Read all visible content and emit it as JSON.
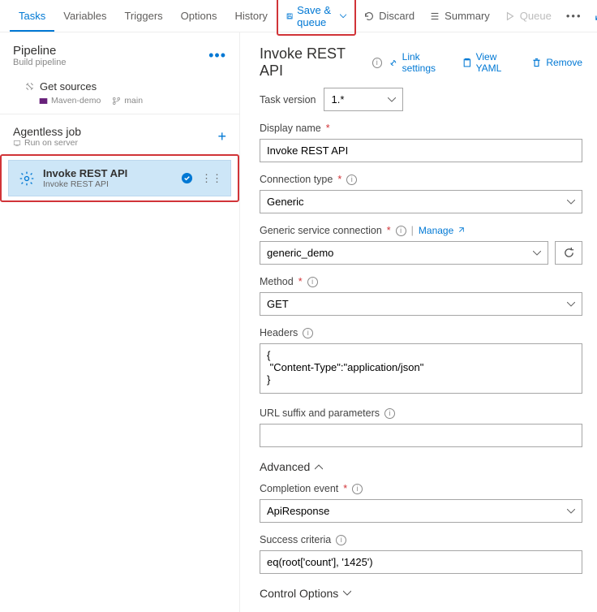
{
  "tabs": [
    "Tasks",
    "Variables",
    "Triggers",
    "Options",
    "History"
  ],
  "toolbar": {
    "save_queue": "Save & queue",
    "discard": "Discard",
    "summary": "Summary",
    "queue": "Queue"
  },
  "left": {
    "pipeline_title": "Pipeline",
    "pipeline_sub": "Build pipeline",
    "get_sources": "Get sources",
    "repo": "Maven-demo",
    "branch": "main",
    "job_title": "Agentless job",
    "job_sub": "Run on server",
    "task_title": "Invoke REST API",
    "task_sub": "Invoke REST API"
  },
  "right": {
    "title": "Invoke REST API",
    "link_settings": "Link settings",
    "view_yaml": "View YAML",
    "remove": "Remove",
    "task_version_label": "Task version",
    "task_version_value": "1.*",
    "display_name_label": "Display name",
    "display_name_value": "Invoke REST API",
    "conn_type_label": "Connection type",
    "conn_type_value": "Generic",
    "service_conn_label": "Generic service connection",
    "service_conn_value": "generic_demo",
    "manage": "Manage",
    "method_label": "Method",
    "method_value": "GET",
    "headers_label": "Headers",
    "headers_value": "{\n \"Content-Type\":\"application/json\"\n}",
    "url_suffix_label": "URL suffix and parameters",
    "url_suffix_value": "",
    "advanced": "Advanced",
    "completion_label": "Completion event",
    "completion_value": "ApiResponse",
    "success_label": "Success criteria",
    "success_value": "eq(root['count'], '1425')",
    "control_options": "Control Options"
  }
}
